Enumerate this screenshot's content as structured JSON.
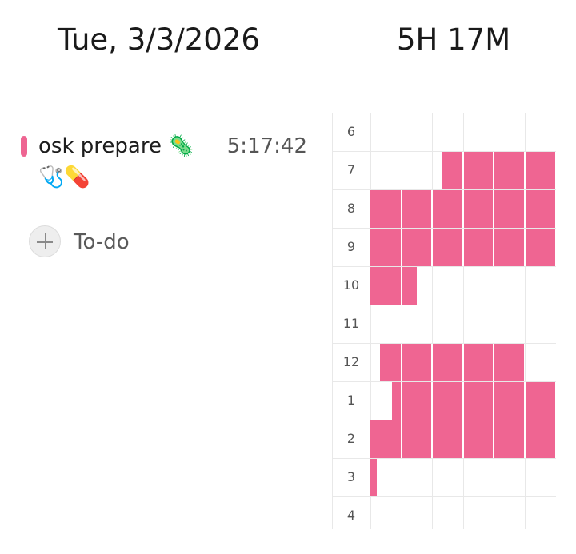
{
  "header": {
    "date": "Tue, 3/3/2026",
    "total": "5H 17M"
  },
  "task": {
    "title": "osk prepare 🦠",
    "time": "5:17:42",
    "emojis": "🩺💊",
    "color": "#ee6592"
  },
  "todo": {
    "label": "To-do",
    "icon": "plus-icon"
  },
  "timeline": {
    "hours": [
      "6",
      "7",
      "8",
      "9",
      "10",
      "11",
      "12",
      "1",
      "2",
      "3",
      "4"
    ],
    "color": "#ef6592",
    "minutes_per_cell": 10,
    "active_ranges": [
      {
        "hour": "7",
        "from_min": 23,
        "to_min": 60
      },
      {
        "hour": "8",
        "from_min": 0,
        "to_min": 60
      },
      {
        "hour": "9",
        "from_min": 0,
        "to_min": 60
      },
      {
        "hour": "10",
        "from_min": 0,
        "to_min": 15
      },
      {
        "hour": "12",
        "from_min": 3,
        "to_min": 50
      },
      {
        "hour": "1",
        "from_min": 7,
        "to_min": 60
      },
      {
        "hour": "2",
        "from_min": 0,
        "to_min": 60
      },
      {
        "hour": "3",
        "from_min": 0,
        "to_min": 2
      }
    ]
  }
}
